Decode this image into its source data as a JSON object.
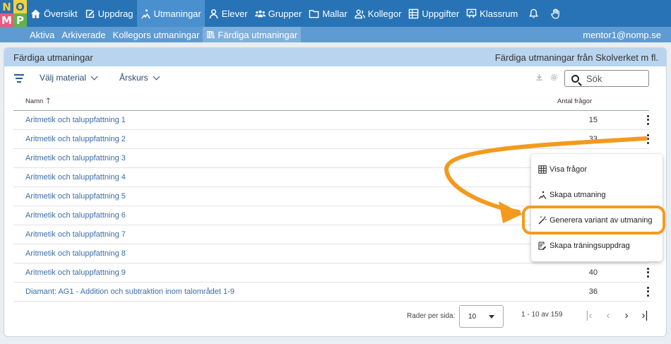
{
  "logo": {
    "letters": [
      "N",
      "O",
      "M",
      "P"
    ]
  },
  "nav": {
    "items": [
      {
        "label": "Översikt",
        "icon": "home-icon"
      },
      {
        "label": "Uppdrag",
        "icon": "edit-icon"
      },
      {
        "label": "Utmaningar",
        "icon": "climber-icon",
        "active": true
      },
      {
        "label": "Elever",
        "icon": "person-icon"
      },
      {
        "label": "Grupper",
        "icon": "group-icon"
      },
      {
        "label": "Mallar",
        "icon": "folder-icon"
      },
      {
        "label": "Kollegor",
        "icon": "colleague-icon"
      },
      {
        "label": "Uppgifter",
        "icon": "table-icon"
      },
      {
        "label": "Klassrum",
        "icon": "classroom-icon"
      }
    ],
    "bell_icon": "bell-icon",
    "hand_icon": "hand-icon"
  },
  "subnav": {
    "items": [
      {
        "label": "Aktiva"
      },
      {
        "label": "Arkiverade"
      },
      {
        "label": "Kollegors utmaningar"
      },
      {
        "label": "Färdiga utmaningar",
        "active": true
      }
    ],
    "user_email": "mentor1@nomp.se"
  },
  "card": {
    "title": "Färdiga utmaningar",
    "subtitle": "Färdiga utmaningar från Skolverket m fl."
  },
  "filters": {
    "material_label": "Välj material",
    "grade_label": "Årskurs",
    "search_placeholder": "Sök"
  },
  "table": {
    "columns": {
      "name": "Namn",
      "count": "Antal frågor"
    },
    "rows": [
      {
        "name": "Aritmetik och taluppfattning 1",
        "count": "15"
      },
      {
        "name": "Aritmetik och taluppfattning 2",
        "count": "33"
      },
      {
        "name": "Aritmetik och taluppfattning 3",
        "count": ""
      },
      {
        "name": "Aritmetik och taluppfattning 4",
        "count": ""
      },
      {
        "name": "Aritmetik och taluppfattning 5",
        "count": ""
      },
      {
        "name": "Aritmetik och taluppfattning 6",
        "count": ""
      },
      {
        "name": "Aritmetik och taluppfattning 7",
        "count": ""
      },
      {
        "name": "Aritmetik och taluppfattning 8",
        "count": ""
      },
      {
        "name": "Aritmetik och taluppfattning 9",
        "count": "40"
      },
      {
        "name": "Diamant: AG1 - Addition och subtraktion inom talområdet 1-9",
        "count": "36"
      }
    ]
  },
  "pagination": {
    "rows_label": "Rader per sida:",
    "rows_value": "10",
    "range": "1 - 10 av 159"
  },
  "menu": {
    "items": [
      {
        "label": "Visa frågor",
        "icon": "grid-icon"
      },
      {
        "label": "Skapa utmaning",
        "icon": "climber-icon"
      },
      {
        "label": "Generera variant av utmaning",
        "icon": "magic-wand-icon",
        "highlighted": true
      },
      {
        "label": "Skapa träningsuppdrag",
        "icon": "assignment-icon"
      }
    ]
  },
  "colors": {
    "topbar": "#2873b5",
    "subbar": "#5e9bd3",
    "card_header": "#b9d4ef",
    "link": "#3b6ea8",
    "annotation": "#f39a1e"
  }
}
